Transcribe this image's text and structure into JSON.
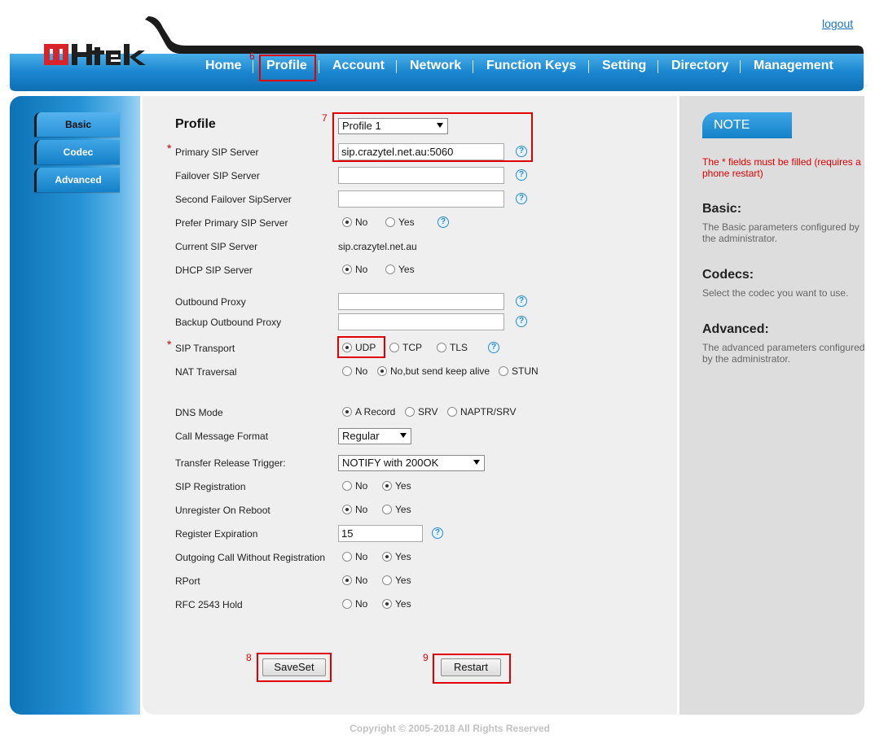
{
  "header": {
    "logout_label": "logout",
    "nav": [
      "Home",
      "Profile",
      "Account",
      "Network",
      "Function Keys",
      "Setting",
      "Directory",
      "Management"
    ],
    "logo_alt": "Htek"
  },
  "sidebar": {
    "items": [
      {
        "label": "Basic",
        "active": true
      },
      {
        "label": "Codec",
        "active": false
      },
      {
        "label": "Advanced",
        "active": false
      }
    ]
  },
  "main": {
    "title": "Profile",
    "profile_select": "Profile 1",
    "labels": {
      "primary_sip_server": "Primary SIP Server",
      "failover_sip_server": "Failover SIP Server",
      "second_failover": "Second Failover SipServer",
      "prefer_primary": "Prefer Primary SIP Server",
      "current_sip_server": "Current SIP Server",
      "dhcp_sip_server": "DHCP SIP Server",
      "outbound_proxy": "Outbound Proxy",
      "backup_outbound_proxy": "Backup Outbound Proxy",
      "sip_transport": "SIP Transport",
      "nat_traversal": "NAT Traversal",
      "dns_mode": "DNS Mode",
      "call_message_format": "Call Message Format",
      "transfer_release_trigger": "Transfer Release Trigger:",
      "sip_registration": "SIP Registration",
      "unregister_on_reboot": "Unregister On Reboot",
      "register_expiration": "Register Expiration",
      "outgoing_without_reg": "Outgoing Call Without Registration",
      "rport": "RPort",
      "rfc2543_hold": "RFC 2543 Hold"
    },
    "values": {
      "primary_sip_server": "sip.crazytel.net.au:5060",
      "failover_sip_server": "",
      "second_failover": "",
      "current_sip_server": "sip.crazytel.net.au",
      "outbound_proxy": "",
      "backup_outbound_proxy": "",
      "call_message_format": "Regular",
      "transfer_release_trigger": "NOTIFY with 200OK",
      "register_expiration": "15"
    },
    "options": {
      "no": "No",
      "yes": "Yes",
      "udp": "UDP",
      "tcp": "TCP",
      "tls": "TLS",
      "no_keep_alive": "No,but send keep alive",
      "stun": "STUN",
      "a_record": "A Record",
      "srv": "SRV",
      "naptr_srv": "NAPTR/SRV"
    },
    "required_star": "*",
    "help_glyph": "?",
    "buttons": {
      "saveset": "SaveSet",
      "restart": "Restart"
    },
    "step_labels": {
      "s6": "6",
      "s7": "7",
      "s8": "8",
      "s9": "9"
    }
  },
  "note": {
    "tab_label": "NOTE",
    "warning": "The * fields must be filled (requires a phone restart)",
    "sections": [
      {
        "heading": "Basic:",
        "text": "The Basic parameters configured by the administrator."
      },
      {
        "heading": "Codecs:",
        "text": "Select the codec you want to use."
      },
      {
        "heading": "Advanced:",
        "text": "The advanced parameters configured by the administrator."
      }
    ]
  },
  "footer": {
    "copyright": "Copyright © 2005-2018 All Rights Reserved"
  },
  "colors": {
    "accent_blue": "#1a86cf",
    "highlight_red": "#e00000",
    "dark_header": "#1b1b1b"
  }
}
